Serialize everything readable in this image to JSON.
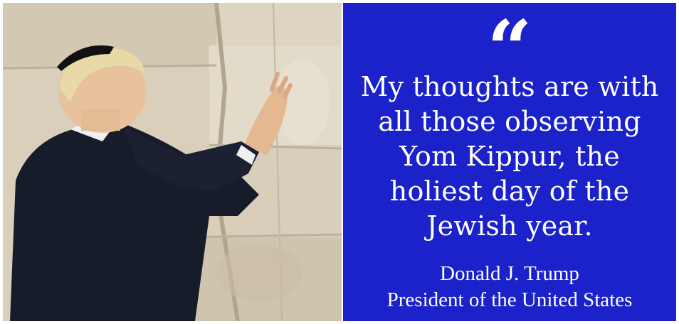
{
  "quote": {
    "mark": "“",
    "text": "My thoughts are with all those observing Yom Kippur, the holiest day of the Jewish year."
  },
  "attribution": {
    "name": "Donald J. Trump",
    "title": "President of the United States"
  },
  "colors": {
    "panel_background": "#1b22c9",
    "text": "#ffffff"
  }
}
